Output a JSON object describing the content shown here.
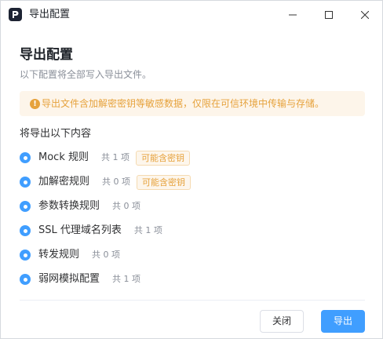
{
  "window": {
    "title": "导出配置"
  },
  "dialog": {
    "heading": "导出配置",
    "subtitle": "以下配置将全部写入导出文件。",
    "warning": {
      "icon": "!",
      "text": "导出文件含加解密密钥等敏感数据，仅限在可信环境中传输与存储。"
    },
    "section_title": "将导出以下内容",
    "items": [
      {
        "label": "Mock 规则",
        "count": "共 1 项",
        "tag": "可能含密钥"
      },
      {
        "label": "加解密规则",
        "count": "共 0 项",
        "tag": "可能含密钥"
      },
      {
        "label": "参数转换规则",
        "count": "共 0 项"
      },
      {
        "label": "SSL 代理域名列表",
        "count": "共 1 项"
      },
      {
        "label": "转发规则",
        "count": "共 0 项"
      },
      {
        "label": "弱网模拟配置",
        "count": "共 1 项"
      }
    ],
    "buttons": {
      "cancel": "关闭",
      "export": "导出"
    }
  },
  "colors": {
    "accent": "#409eff",
    "warning": "#e6a23c",
    "warning_bg": "#fdf5ea"
  }
}
